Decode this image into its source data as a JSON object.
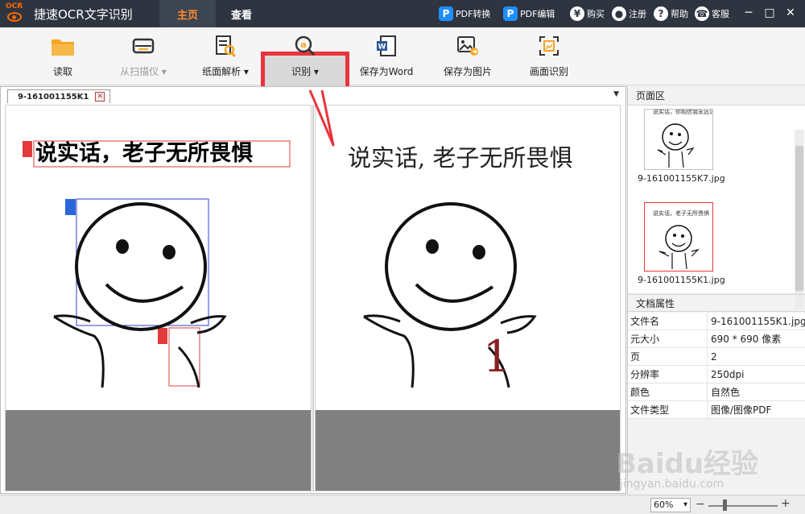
{
  "titlebar": {
    "logo_text": "OCR",
    "app_title": "捷速OCR文字识别",
    "tabs": [
      {
        "label": "主页"
      },
      {
        "label": "查看"
      }
    ],
    "links": [
      {
        "label": "PDF转换",
        "icon": "pdf-convert-icon"
      },
      {
        "label": "PDF编辑",
        "icon": "pdf-edit-icon"
      },
      {
        "label": "购买",
        "icon": "cart-icon"
      },
      {
        "label": "注册",
        "icon": "user-icon"
      },
      {
        "label": "帮助",
        "icon": "help-icon"
      },
      {
        "label": "客服",
        "icon": "phone-icon"
      }
    ]
  },
  "toolbar": {
    "items": [
      {
        "label": "读取",
        "icon": "folder-icon"
      },
      {
        "label": "从扫描仪 ▾",
        "icon": "scanner-icon",
        "disabled": true
      },
      {
        "label": "纸面解析 ▾",
        "icon": "page-analyze-icon"
      },
      {
        "label": "识别 ▾",
        "icon": "recognize-icon"
      },
      {
        "label": "保存为Word",
        "icon": "word-icon"
      },
      {
        "label": "保存为图片",
        "icon": "save-image-icon"
      },
      {
        "label": "画面识别",
        "icon": "screen-recognize-icon"
      }
    ]
  },
  "document": {
    "tab_name": "9-161001155K1",
    "left_text": "说实话，老子无所畏惧",
    "right_text": "说实话, 老子无所畏惧",
    "right_number": "1"
  },
  "page_panel": {
    "title": "页面区",
    "thumbs": [
      {
        "label": "9-161001155K7.jpg",
        "caption": "说实话，你相信我永远公开"
      },
      {
        "label": "9-161001155K1.jpg",
        "caption": "说实话，老子无所畏惧"
      }
    ]
  },
  "properties": {
    "title": "文档属性",
    "rows": [
      {
        "key": "文件名",
        "value": "9-161001155K1.jpg"
      },
      {
        "key": "元大小",
        "value": "690 * 690 像素"
      },
      {
        "key": "页",
        "value": "2"
      },
      {
        "key": "分辨率",
        "value": "250dpi"
      },
      {
        "key": "颜色",
        "value": "自然色"
      },
      {
        "key": "文件类型",
        "value": "图像/图像PDF"
      }
    ]
  },
  "statusbar": {
    "zoom": "60%"
  },
  "watermark": {
    "text": "Baidu经验",
    "sub": "jingyan.baidu.com"
  }
}
